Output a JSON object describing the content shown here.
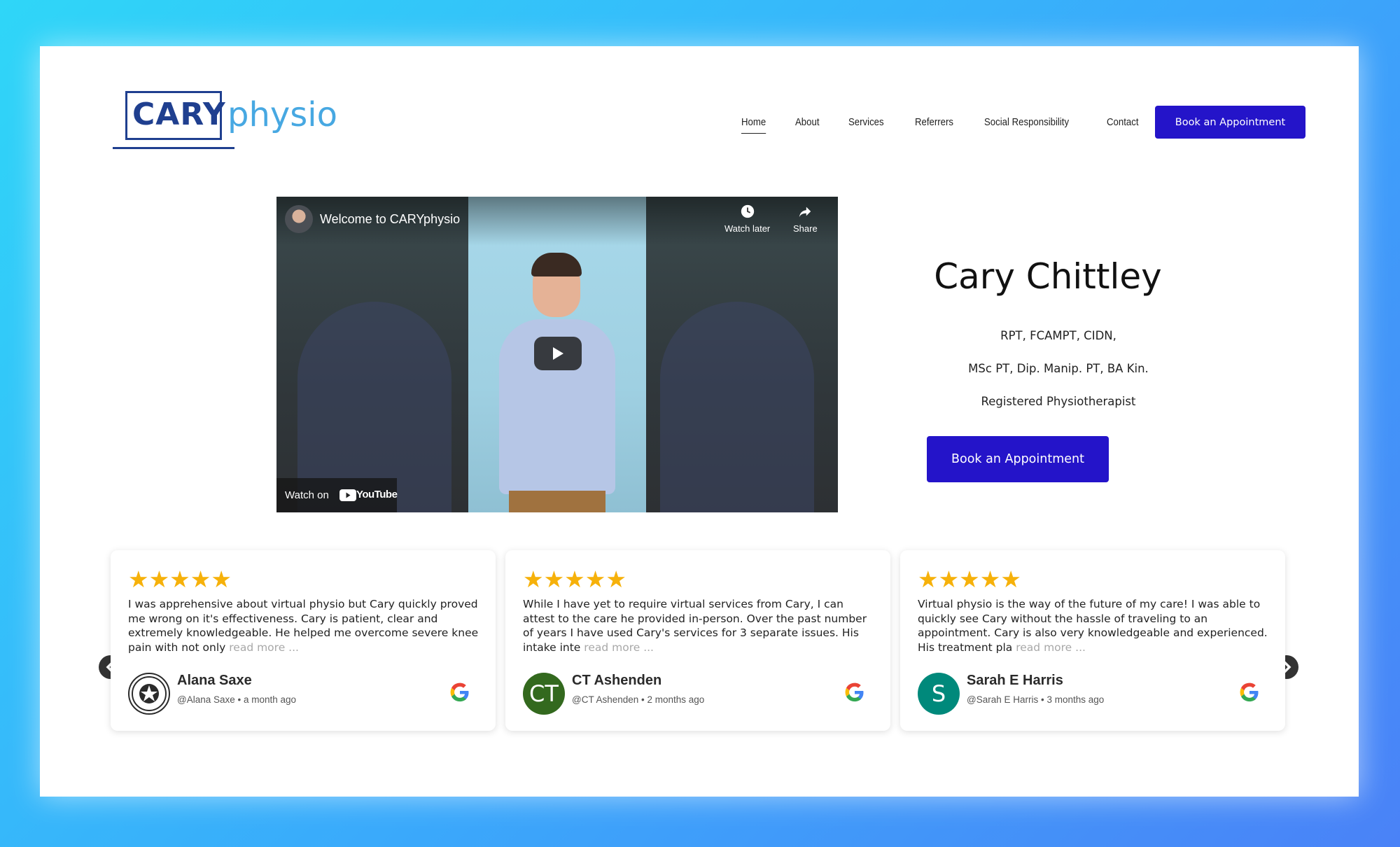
{
  "logo": {
    "cary": "CARY",
    "physio": "physio"
  },
  "nav": {
    "items": [
      "Home",
      "About",
      "Services",
      "Referrers",
      "Social Responsibility",
      "Contact"
    ],
    "active": "Home"
  },
  "header": {
    "book_label": "Book an Appointment"
  },
  "video": {
    "title": "Welcome to CARYphysio",
    "watch_later": "Watch later",
    "share": "Share",
    "watch_on": "Watch on",
    "youtube": "YouTube"
  },
  "profile": {
    "name": "Cary Chittley",
    "credentials_1": "RPT, FCAMPT, CIDN,",
    "credentials_2": "MSc PT, Dip. Manip. PT, BA Kin.",
    "title": "Registered Physiotherapist",
    "book_label": "Book an Appointment"
  },
  "reviews": [
    {
      "stars": "★★★★★",
      "text": "I was apprehensive about virtual physio but Cary quickly proved me wrong on it's effectiveness. Cary is patient, clear and extremely knowledgeable. He helped me overcome severe knee pain with not only",
      "read_more": "read more ...",
      "name": "Alana Saxe",
      "meta": "@Alana Saxe • a month ago",
      "avatar_text": "",
      "avatar_color": "#2b2b2b"
    },
    {
      "stars": "★★★★★",
      "text": "While I have yet to require virtual services from Cary, I can attest to the care he provided in-person. Over the past number of years I have used Cary's services for 3 separate issues. His intake inte",
      "read_more": "read more ...",
      "name": "CT Ashenden",
      "meta": "@CT Ashenden • 2 months ago",
      "avatar_text": "CT",
      "avatar_color": "#33691e"
    },
    {
      "stars": "★★★★★",
      "text": "Virtual physio is the way of the future of my care! I was able to quickly see Cary without the hassle of traveling to an appointment. Cary is also very knowledgeable and experienced. His treatment pla",
      "read_more": "read more ...",
      "name": "Sarah E Harris",
      "meta": "@Sarah E Harris • 3 months ago",
      "avatar_text": "S",
      "avatar_color": "#00897b"
    }
  ],
  "colors": {
    "primary": "#2414c9",
    "logo_dark": "#1f3f8f",
    "logo_light": "#47a8e2",
    "star": "#f6b10a"
  }
}
